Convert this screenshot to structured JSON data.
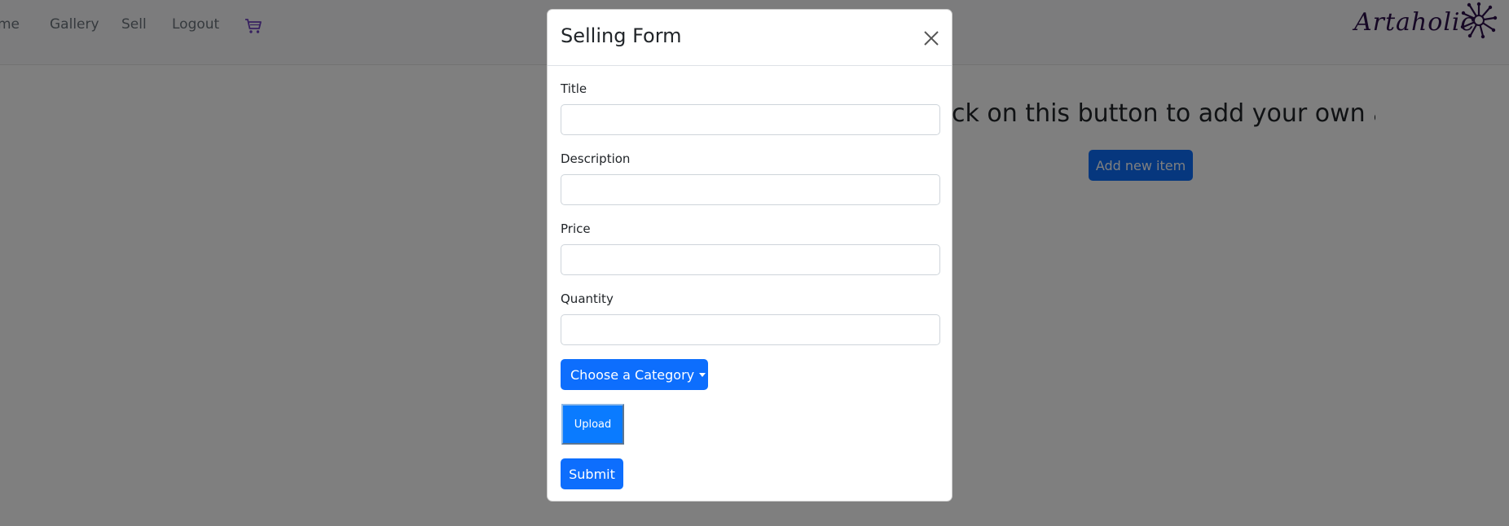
{
  "navbar": {
    "items": [
      {
        "label": "me"
      },
      {
        "label": "Gallery"
      },
      {
        "label": "Sell"
      },
      {
        "label": "Logout"
      }
    ],
    "cart_icon": "cart-icon",
    "logo_text": "Artaholic",
    "logo_icon": "sunburst-logo-icon"
  },
  "hero": {
    "text": "ck on this button to add your own art",
    "add_button": "Add new item"
  },
  "modal": {
    "title": "Selling Form",
    "close_icon": "close-icon",
    "fields": [
      {
        "label": "Title",
        "value": ""
      },
      {
        "label": "Description",
        "value": ""
      },
      {
        "label": "Price",
        "value": ""
      },
      {
        "label": "Quantity",
        "value": ""
      }
    ],
    "category_button": "Choose a Category",
    "upload_button": "Upload",
    "submit_button": "Submit"
  },
  "colors": {
    "primary": "#0d6efd",
    "backdrop": "rgba(0,0,0,0.5)",
    "logo": "#2c0f4a"
  }
}
